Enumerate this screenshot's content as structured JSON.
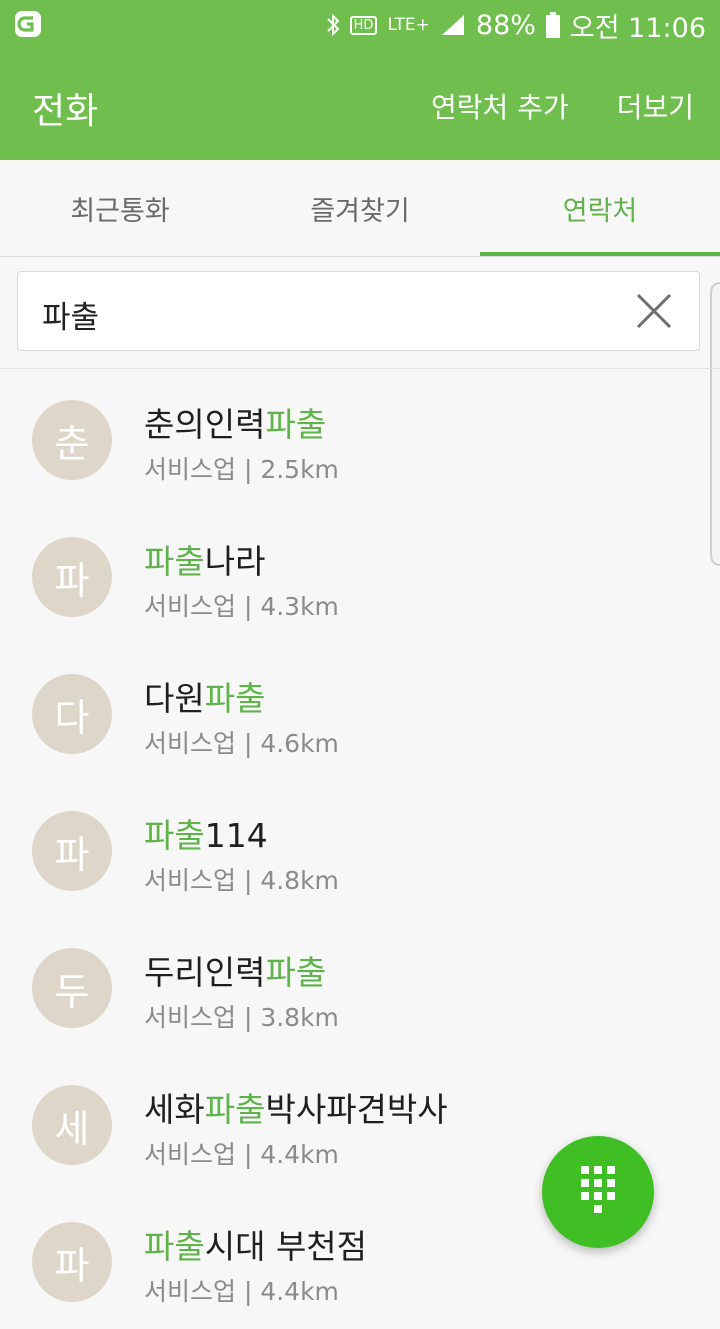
{
  "status_bar": {
    "battery": "88%",
    "time": "오전 11:06",
    "network": "LTE+",
    "hd": "HD",
    "icons": [
      "app-logo-icon",
      "bluetooth-icon",
      "hd-voice-icon",
      "lte-icon",
      "signal-icon",
      "battery-icon"
    ]
  },
  "app_bar": {
    "title": "전화",
    "actions": [
      "연락처 추가",
      "더보기"
    ]
  },
  "tabs": [
    {
      "label": "최근통화",
      "active": false
    },
    {
      "label": "즐겨찾기",
      "active": false
    },
    {
      "label": "연락처",
      "active": true
    }
  ],
  "search": {
    "value": "파출",
    "clear_icon": "close-icon"
  },
  "results": [
    {
      "avatar": "춘",
      "name_parts": [
        "춘의인력",
        "파출",
        ""
      ],
      "category": "서비스업",
      "distance": "2.5km"
    },
    {
      "avatar": "파",
      "name_parts": [
        "",
        "파출",
        "나라"
      ],
      "category": "서비스업",
      "distance": "4.3km"
    },
    {
      "avatar": "다",
      "name_parts": [
        "다원",
        "파출",
        ""
      ],
      "category": "서비스업",
      "distance": "4.6km"
    },
    {
      "avatar": "파",
      "name_parts": [
        "",
        "파출",
        "114"
      ],
      "category": "서비스업",
      "distance": "4.8km"
    },
    {
      "avatar": "두",
      "name_parts": [
        "두리인력",
        "파출",
        ""
      ],
      "category": "서비스업",
      "distance": "3.8km"
    },
    {
      "avatar": "세",
      "name_parts": [
        "세화",
        "파출",
        "박사파견박사"
      ],
      "category": "서비스업",
      "distance": "4.4km"
    },
    {
      "avatar": "파",
      "name_parts": [
        "",
        "파출",
        "시대 부천점"
      ],
      "category": "서비스업",
      "distance": "4.4km"
    }
  ],
  "fab": {
    "icon": "dialpad-icon"
  },
  "colors": {
    "accent": "#6fbe4e",
    "highlight": "#5fb34a",
    "fab": "#3fbf24",
    "avatar_bg": "#ddd6c9"
  }
}
